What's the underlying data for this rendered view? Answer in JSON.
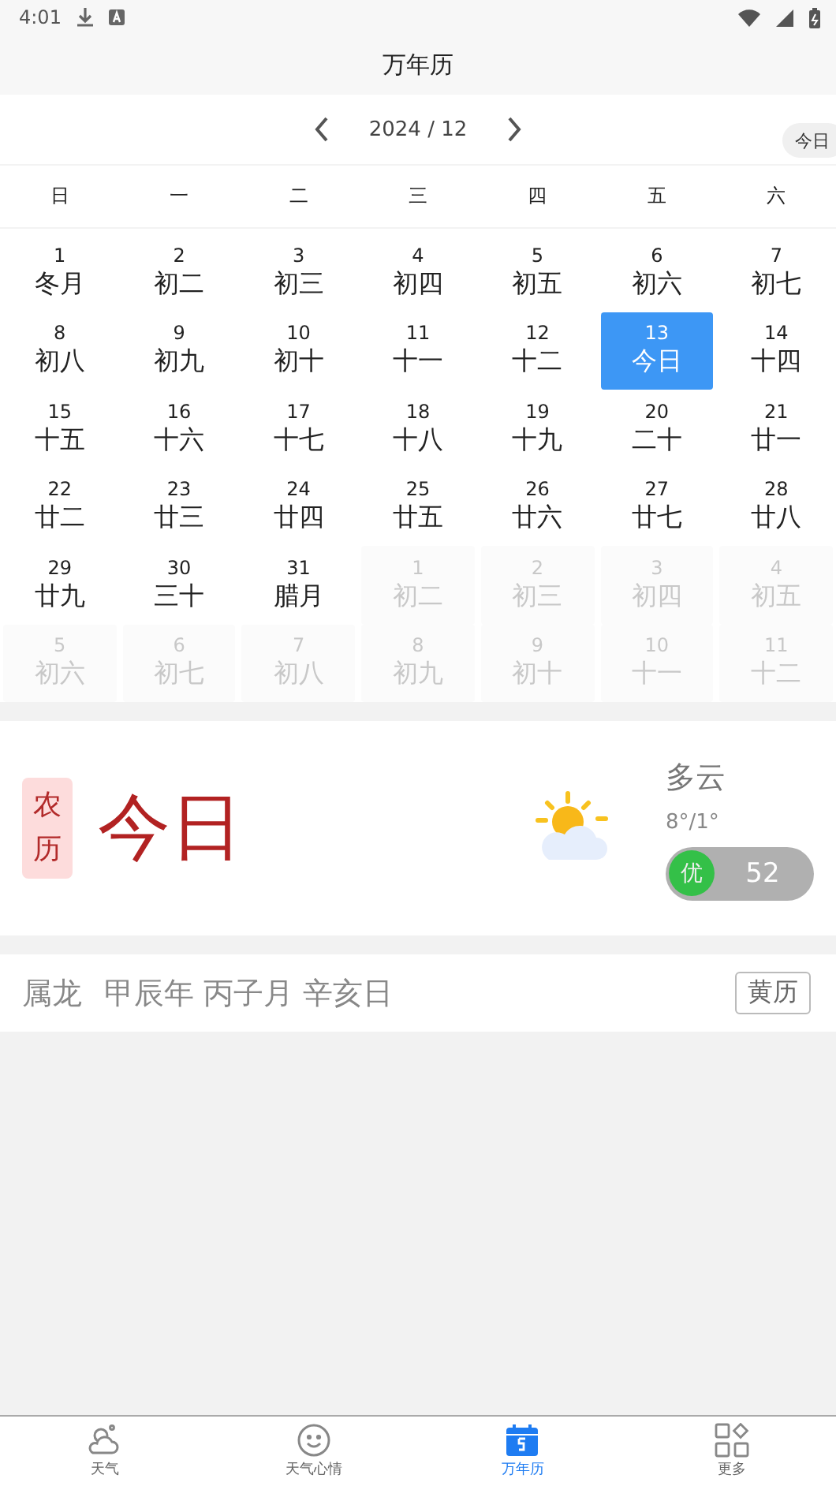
{
  "status_bar": {
    "time": "4:01"
  },
  "title": "万年历",
  "nav": {
    "month": "2024 / 12",
    "today_button": "今日"
  },
  "weekdays": [
    "日",
    "一",
    "二",
    "三",
    "四",
    "五",
    "六"
  ],
  "days": [
    {
      "day": "1",
      "lunar": "冬月",
      "muted": false,
      "selected": false
    },
    {
      "day": "2",
      "lunar": "初二",
      "muted": false,
      "selected": false
    },
    {
      "day": "3",
      "lunar": "初三",
      "muted": false,
      "selected": false
    },
    {
      "day": "4",
      "lunar": "初四",
      "muted": false,
      "selected": false
    },
    {
      "day": "5",
      "lunar": "初五",
      "muted": false,
      "selected": false
    },
    {
      "day": "6",
      "lunar": "初六",
      "muted": false,
      "selected": false
    },
    {
      "day": "7",
      "lunar": "初七",
      "muted": false,
      "selected": false
    },
    {
      "day": "8",
      "lunar": "初八",
      "muted": false,
      "selected": false
    },
    {
      "day": "9",
      "lunar": "初九",
      "muted": false,
      "selected": false
    },
    {
      "day": "10",
      "lunar": "初十",
      "muted": false,
      "selected": false
    },
    {
      "day": "11",
      "lunar": "十一",
      "muted": false,
      "selected": false
    },
    {
      "day": "12",
      "lunar": "十二",
      "muted": false,
      "selected": false
    },
    {
      "day": "13",
      "lunar": "今日",
      "muted": false,
      "selected": true
    },
    {
      "day": "14",
      "lunar": "十四",
      "muted": false,
      "selected": false
    },
    {
      "day": "15",
      "lunar": "十五",
      "muted": false,
      "selected": false
    },
    {
      "day": "16",
      "lunar": "十六",
      "muted": false,
      "selected": false
    },
    {
      "day": "17",
      "lunar": "十七",
      "muted": false,
      "selected": false
    },
    {
      "day": "18",
      "lunar": "十八",
      "muted": false,
      "selected": false
    },
    {
      "day": "19",
      "lunar": "十九",
      "muted": false,
      "selected": false
    },
    {
      "day": "20",
      "lunar": "二十",
      "muted": false,
      "selected": false
    },
    {
      "day": "21",
      "lunar": "廿一",
      "muted": false,
      "selected": false
    },
    {
      "day": "22",
      "lunar": "廿二",
      "muted": false,
      "selected": false
    },
    {
      "day": "23",
      "lunar": "廿三",
      "muted": false,
      "selected": false
    },
    {
      "day": "24",
      "lunar": "廿四",
      "muted": false,
      "selected": false
    },
    {
      "day": "25",
      "lunar": "廿五",
      "muted": false,
      "selected": false
    },
    {
      "day": "26",
      "lunar": "廿六",
      "muted": false,
      "selected": false
    },
    {
      "day": "27",
      "lunar": "廿七",
      "muted": false,
      "selected": false
    },
    {
      "day": "28",
      "lunar": "廿八",
      "muted": false,
      "selected": false
    },
    {
      "day": "29",
      "lunar": "廿九",
      "muted": false,
      "selected": false
    },
    {
      "day": "30",
      "lunar": "三十",
      "muted": false,
      "selected": false
    },
    {
      "day": "31",
      "lunar": "腊月",
      "muted": false,
      "selected": false
    },
    {
      "day": "1",
      "lunar": "初二",
      "muted": true,
      "selected": false
    },
    {
      "day": "2",
      "lunar": "初三",
      "muted": true,
      "selected": false
    },
    {
      "day": "3",
      "lunar": "初四",
      "muted": true,
      "selected": false
    },
    {
      "day": "4",
      "lunar": "初五",
      "muted": true,
      "selected": false
    },
    {
      "day": "5",
      "lunar": "初六",
      "muted": true,
      "selected": false
    },
    {
      "day": "6",
      "lunar": "初七",
      "muted": true,
      "selected": false
    },
    {
      "day": "7",
      "lunar": "初八",
      "muted": true,
      "selected": false
    },
    {
      "day": "8",
      "lunar": "初九",
      "muted": true,
      "selected": false
    },
    {
      "day": "9",
      "lunar": "初十",
      "muted": true,
      "selected": false
    },
    {
      "day": "10",
      "lunar": "十一",
      "muted": true,
      "selected": false
    },
    {
      "day": "11",
      "lunar": "十二",
      "muted": true,
      "selected": false
    }
  ],
  "today_card": {
    "badge": "农历",
    "date": "今日",
    "weather": "多云",
    "temperature": "8°/1°",
    "aqi_label": "优",
    "aqi_value": "52"
  },
  "almanac": {
    "zodiac": "属龙",
    "ganzhi": "甲辰年 丙子月 辛亥日",
    "button": "黄历"
  },
  "tabs": [
    {
      "label": "天气",
      "kind": "weather",
      "selected": false
    },
    {
      "label": "天气心情",
      "kind": "mood",
      "selected": false
    },
    {
      "label": "万年历",
      "kind": "calendar",
      "selected": true
    },
    {
      "label": "更多",
      "kind": "more",
      "selected": false
    }
  ]
}
